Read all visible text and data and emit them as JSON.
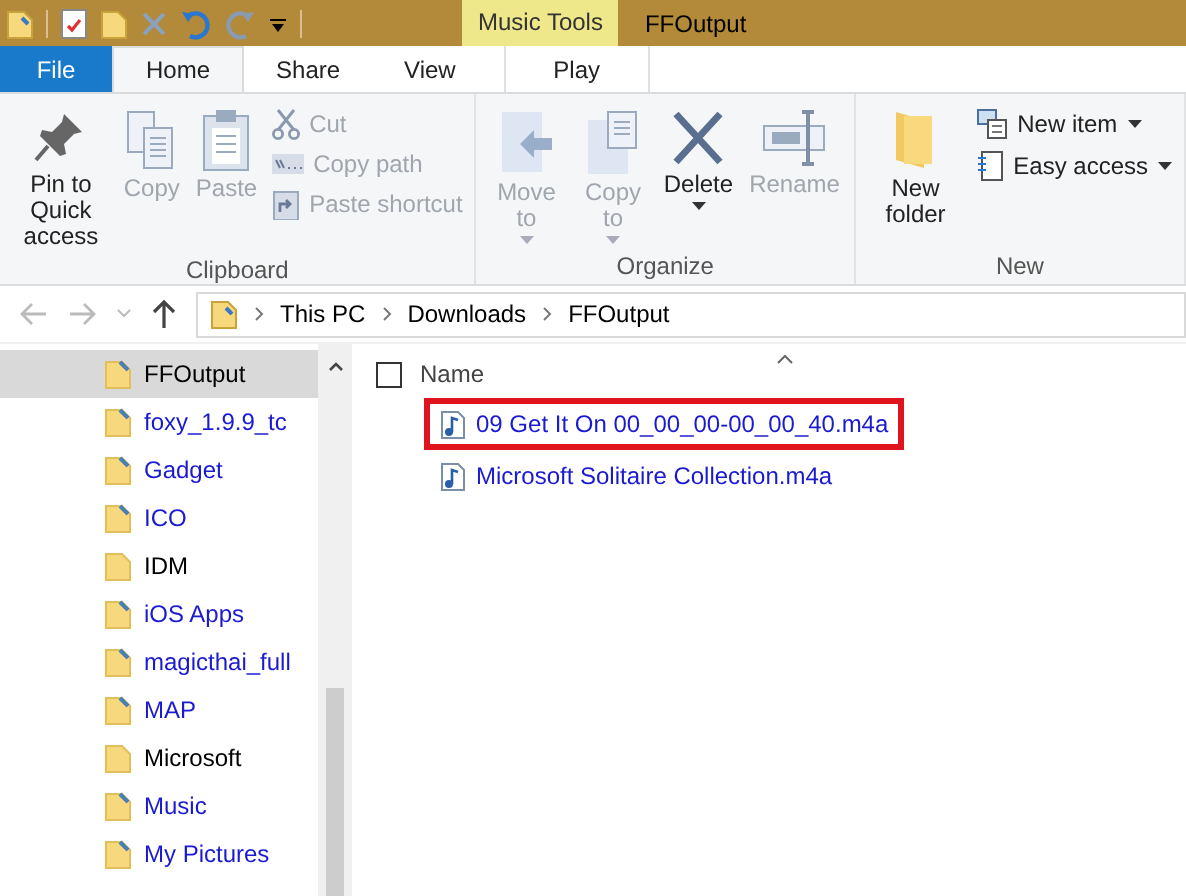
{
  "window": {
    "title": "FFOutput",
    "context_tab_group": "Music Tools"
  },
  "ribbon_tabs": [
    {
      "label": "File",
      "kind": "file",
      "selected": false
    },
    {
      "label": "Home",
      "kind": "tab",
      "selected": true
    },
    {
      "label": "Share",
      "kind": "tab",
      "selected": false
    },
    {
      "label": "View",
      "kind": "tab",
      "selected": false
    },
    {
      "label": "Play",
      "kind": "context",
      "selected": false
    }
  ],
  "ribbon_groups": [
    {
      "label": "Clipboard",
      "commands": [
        {
          "label": "Pin to Quick access",
          "kind": "large",
          "disabled": false,
          "dropdown": false
        },
        {
          "label": "Copy",
          "kind": "large",
          "disabled": true,
          "dropdown": false
        },
        {
          "label": "Paste",
          "kind": "large",
          "disabled": true,
          "dropdown": false
        },
        {
          "kind": "stack",
          "items": [
            {
              "label": "Cut",
              "disabled": true,
              "dropdown": false
            },
            {
              "label": "Copy path",
              "disabled": true,
              "dropdown": false
            },
            {
              "label": "Paste shortcut",
              "disabled": true,
              "dropdown": false
            }
          ]
        }
      ]
    },
    {
      "label": "Organize",
      "commands": [
        {
          "label": "Move to",
          "kind": "large",
          "disabled": true,
          "dropdown": true
        },
        {
          "label": "Copy to",
          "kind": "large",
          "disabled": true,
          "dropdown": true
        },
        {
          "label": "Delete",
          "kind": "large",
          "disabled": false,
          "dropdown": true
        },
        {
          "label": "Rename",
          "kind": "large",
          "disabled": true,
          "dropdown": false
        }
      ]
    },
    {
      "label": "New",
      "commands": [
        {
          "label": "New folder",
          "kind": "large",
          "disabled": false,
          "dropdown": false
        },
        {
          "kind": "stack",
          "items": [
            {
              "label": "New item",
              "disabled": false,
              "dropdown": true
            },
            {
              "label": "Easy access",
              "disabled": false,
              "dropdown": true
            }
          ]
        }
      ]
    }
  ],
  "address_bar": {
    "path": [
      "This PC",
      "Downloads",
      "FFOutput"
    ]
  },
  "sidebar": {
    "items": [
      {
        "label": "FFOutput",
        "compressed": true,
        "selected": true
      },
      {
        "label": "foxy_1.9.9_tc",
        "compressed": true,
        "selected": false
      },
      {
        "label": "Gadget",
        "compressed": true,
        "selected": false
      },
      {
        "label": "ICO",
        "compressed": true,
        "selected": false
      },
      {
        "label": "IDM",
        "compressed": false,
        "selected": false
      },
      {
        "label": "iOS Apps",
        "compressed": true,
        "selected": false
      },
      {
        "label": "magicthai_full",
        "compressed": true,
        "selected": false
      },
      {
        "label": "MAP",
        "compressed": true,
        "selected": false
      },
      {
        "label": "Microsoft",
        "compressed": false,
        "selected": false
      },
      {
        "label": "Music",
        "compressed": true,
        "selected": false
      },
      {
        "label": "My Pictures",
        "compressed": true,
        "selected": false
      }
    ]
  },
  "file_list": {
    "columns": [
      "Name"
    ],
    "select_all_checked": false,
    "files": [
      {
        "name": "09 Get It On 00_00_00-00_00_40.m4a",
        "compressed": true,
        "highlighted": true
      },
      {
        "name": "Microsoft Solitaire Collection.m4a",
        "compressed": true,
        "highlighted": false
      }
    ]
  }
}
